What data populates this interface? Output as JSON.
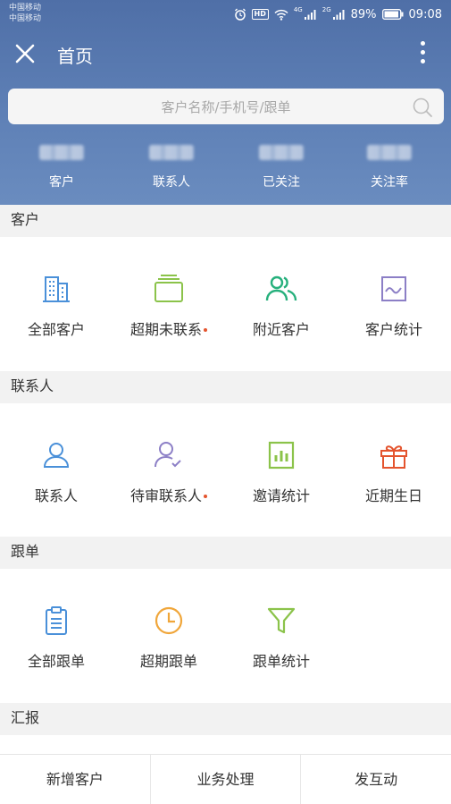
{
  "status_bar": {
    "carrier_1": "中国移动",
    "carrier_2": "中国移动",
    "hd": "HD",
    "net_1": "4G",
    "net_2": "2G",
    "battery": "89%",
    "time": "09:08"
  },
  "header": {
    "title": "首页"
  },
  "search": {
    "placeholder": "客户名称/手机号/跟单"
  },
  "stats": [
    {
      "label": "客户"
    },
    {
      "label": "联系人"
    },
    {
      "label": "已关注"
    },
    {
      "label": "关注率"
    }
  ],
  "sections": {
    "customers": {
      "title": "客户",
      "items": [
        {
          "label": "全部客户",
          "icon": "building-icon"
        },
        {
          "label": "超期未联系",
          "icon": "stacked-cards-icon"
        },
        {
          "label": "附近客户",
          "icon": "people-icon"
        },
        {
          "label": "客户统计",
          "icon": "line-chart-icon"
        }
      ]
    },
    "contacts": {
      "title": "联系人",
      "items": [
        {
          "label": "联系人",
          "icon": "person-icon"
        },
        {
          "label": "待审联系人",
          "icon": "person-check-icon"
        },
        {
          "label": "邀请统计",
          "icon": "bar-chart-icon"
        },
        {
          "label": "近期生日",
          "icon": "gift-icon"
        }
      ]
    },
    "orders": {
      "title": "跟单",
      "items": [
        {
          "label": "全部跟单",
          "icon": "clipboard-icon"
        },
        {
          "label": "超期跟单",
          "icon": "clock-icon"
        },
        {
          "label": "跟单统计",
          "icon": "filter-icon"
        }
      ]
    },
    "reports": {
      "title": "汇报"
    }
  },
  "bottom_bar": {
    "tabs": [
      {
        "label": "新增客户"
      },
      {
        "label": "业务处理"
      },
      {
        "label": "发互动"
      }
    ]
  },
  "colors": {
    "header": "#5e80b6",
    "blue": "#4a90d9",
    "green": "#8bc34a",
    "teal": "#26b07c",
    "purple": "#8c7fc6",
    "orange": "#f0a63a",
    "red": "#e4542e"
  }
}
